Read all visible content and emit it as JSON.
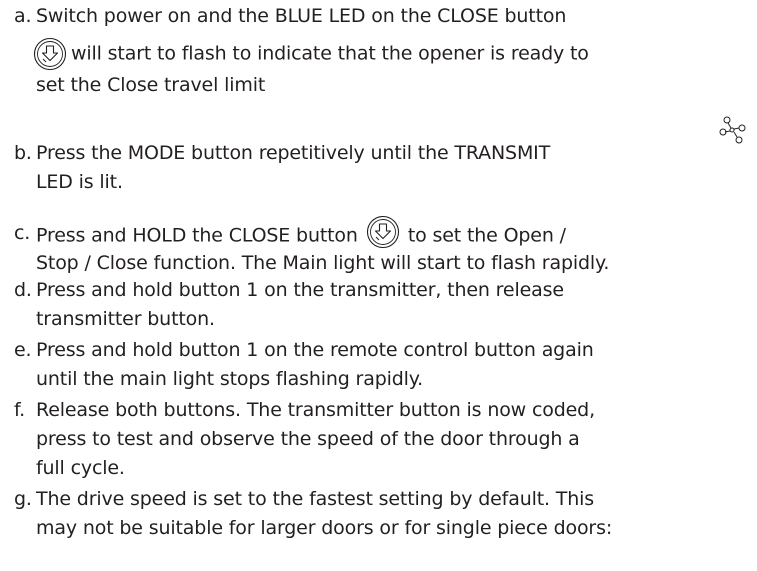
{
  "steps": [
    {
      "letter": "a.",
      "line1": "Switch power on and the BLUE LED on the CLOSE button",
      "icon": "close-down-arrow-icon",
      "line2": "will start to flash to indicate that the opener is ready to",
      "line3": "set the Close travel limit"
    },
    {
      "letter": "b.",
      "line1": "Press the MODE button repetitively until the TRANSMIT",
      "icon": "transmit-icon",
      "line2": "LED is lit."
    },
    {
      "letter": "c.",
      "line1a": "Press and HOLD the CLOSE button",
      "icon": "close-down-arrow-icon",
      "line1b": "to set the Open /",
      "line2": "Stop  / Close function. The Main light will start to flash rapidly."
    },
    {
      "letter": "d.",
      "line1": "Press and hold button 1 on the transmitter, then release",
      "line2": "transmitter button."
    },
    {
      "letter": "e.",
      "line1": "Press and hold button 1 on the remote control button again",
      "line2": "until the main light stops flashing rapidly."
    },
    {
      "letter": "f.",
      "line1": "Release both buttons. The transmitter button is now coded,",
      "line2": "press to test and observe the speed of the door through a",
      "line3": "full cycle."
    },
    {
      "letter": "g.",
      "line1": "The drive speed is set to the fastest setting by default. This",
      "line2": "may not be suitable for larger doors or for single piece doors:"
    }
  ],
  "colors": {
    "text": "#231f20",
    "icon": "#231f20"
  }
}
